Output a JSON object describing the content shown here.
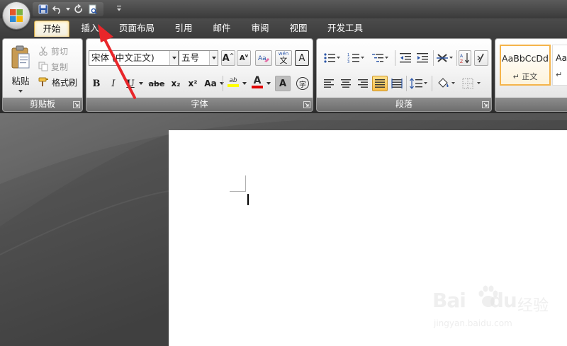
{
  "tabs": [
    "开始",
    "插入",
    "页面布局",
    "引用",
    "邮件",
    "审阅",
    "视图",
    "开发工具"
  ],
  "clipboard": {
    "paste_label": "粘贴",
    "cut_label": "剪切",
    "copy_label": "复制",
    "format_painter_label": "格式刷",
    "group_label": "剪贴板"
  },
  "font": {
    "font_name": "宋体 (中文正文)",
    "font_size": "五号",
    "bold": "B",
    "italic": "I",
    "underline": "U",
    "strikethrough": "abe",
    "subscript": "x₂",
    "superscript": "x²",
    "change_case": "Aa",
    "grow_font": "A",
    "shrink_font": "A",
    "char_border": "A",
    "char_shading": "A",
    "font_color": "A",
    "highlight": "ab",
    "phonetic": "文",
    "phonetic_small": "wén",
    "enclose": "字",
    "group_label": "字体"
  },
  "paragraph": {
    "group_label": "段落"
  },
  "styles": {
    "items": [
      {
        "preview": "AaBbCcDd",
        "name": "↵ 正文"
      },
      {
        "preview": "AaB",
        "name": "↵"
      }
    ]
  },
  "watermark": {
    "logo": "Bai",
    "logo_end": "du",
    "brand": "经验",
    "url": "jingyan.baidu.com"
  },
  "colors": {
    "active_tab_border": "#c9a243",
    "highlight_yellow": "#ffff00",
    "font_color_red": "#e00000",
    "arrow_red": "#e8262a",
    "selected_style_border": "#f5b44a"
  }
}
